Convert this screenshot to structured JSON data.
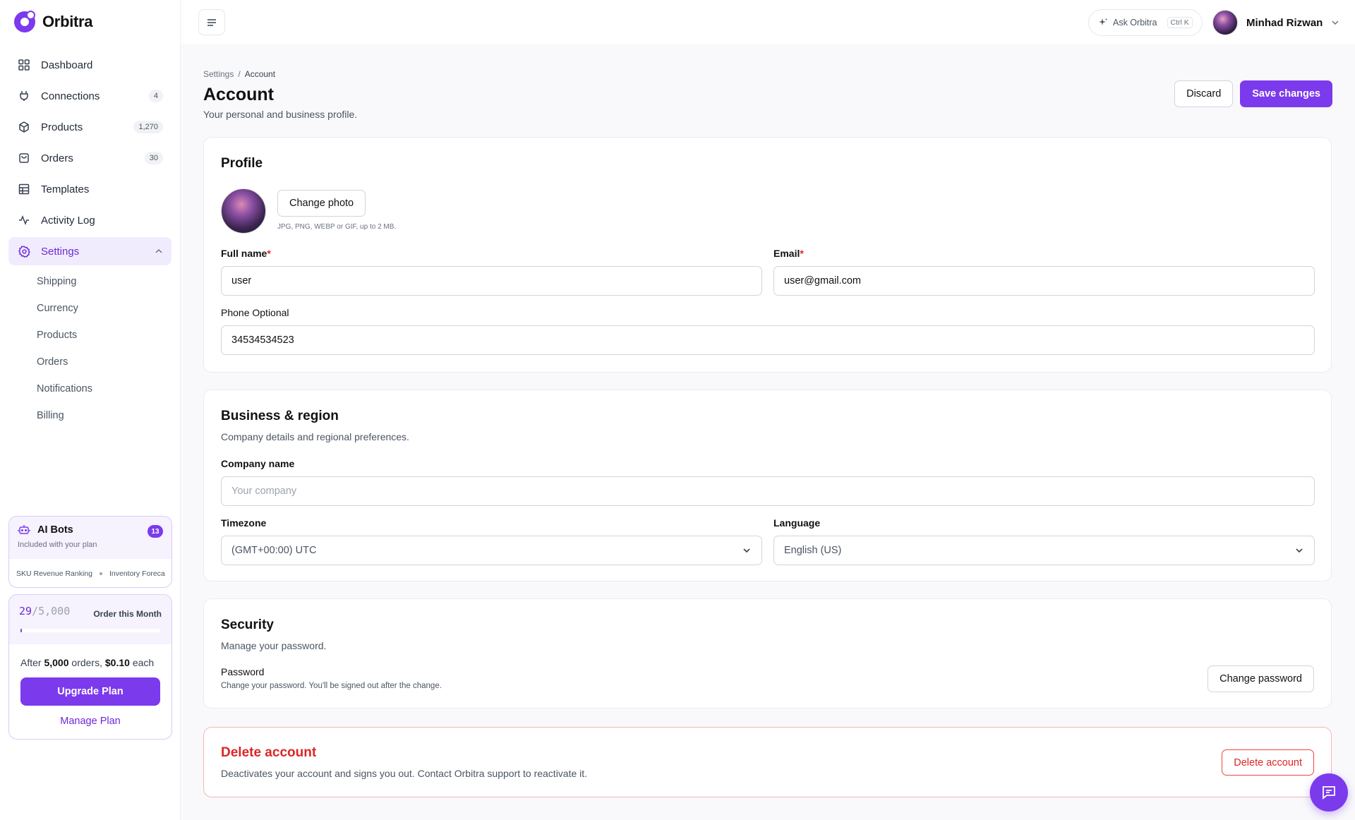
{
  "app": {
    "name": "Orbitra",
    "accent": "#7c3aed"
  },
  "sidebar": {
    "items": [
      {
        "label": "Dashboard",
        "icon": "grid-icon"
      },
      {
        "label": "Connections",
        "icon": "plug-icon",
        "count": "4"
      },
      {
        "label": "Products",
        "icon": "box-icon",
        "count": "1,270"
      },
      {
        "label": "Orders",
        "icon": "bag-icon",
        "count": "30"
      },
      {
        "label": "Templates",
        "icon": "table-icon"
      },
      {
        "label": "Activity Log",
        "icon": "activity-icon"
      },
      {
        "label": "Settings",
        "icon": "gear-icon"
      }
    ],
    "settings_sub": [
      "Shipping",
      "Currency",
      "Products",
      "Orders",
      "Notifications",
      "Billing"
    ],
    "bots": {
      "title": "AI Bots",
      "subtitle": "Included with your plan",
      "count": "13",
      "marquee": [
        "SKU Revenue Ranking",
        "Inventory Foreca"
      ]
    },
    "plan": {
      "used": "29",
      "total": "/5,000",
      "label": "Order this Month",
      "progress_fraction": 0.0058,
      "after_prefix": "After",
      "after_orders": "5,000",
      "after_mid": "orders,",
      "after_price": "$0.10",
      "after_suffix": "each",
      "upgrade": "Upgrade Plan",
      "manage": "Manage Plan"
    }
  },
  "topbar": {
    "ask": "Ask Orbitra",
    "ask_kbd": "Ctrl K",
    "user_name": "Minhad Rizwan"
  },
  "page": {
    "breadcrumb_parent": "Settings",
    "breadcrumb_sep": "/",
    "breadcrumb_current": "Account",
    "title": "Account",
    "subtitle": "Your personal and business profile.",
    "discard": "Discard",
    "save": "Save changes"
  },
  "profile": {
    "title": "Profile",
    "change_photo": "Change photo",
    "photo_hint": "JPG, PNG, WEBP or GIF, up to 2 MB.",
    "full_name_label": "Full name",
    "full_name": "user",
    "email_label": "Email",
    "email": "user@gmail.com",
    "phone_label": "Phone Optional",
    "phone": "34534534523",
    "required_mark": "*"
  },
  "business": {
    "title": "Business & region",
    "desc": "Company details and regional preferences.",
    "company_label": "Company name",
    "company_placeholder": "Your company",
    "timezone_label": "Timezone",
    "timezone": "(GMT+00:00) UTC",
    "language_label": "Language",
    "language": "English (US)"
  },
  "security": {
    "title": "Security",
    "desc": "Manage your password.",
    "password_label": "Password",
    "password_desc": "Change your password. You'll be signed out after the change.",
    "change_password": "Change password"
  },
  "delete": {
    "title": "Delete account",
    "desc": "Deactivates your account and signs you out. Contact Orbitra support to reactivate it.",
    "button": "Delete account"
  }
}
